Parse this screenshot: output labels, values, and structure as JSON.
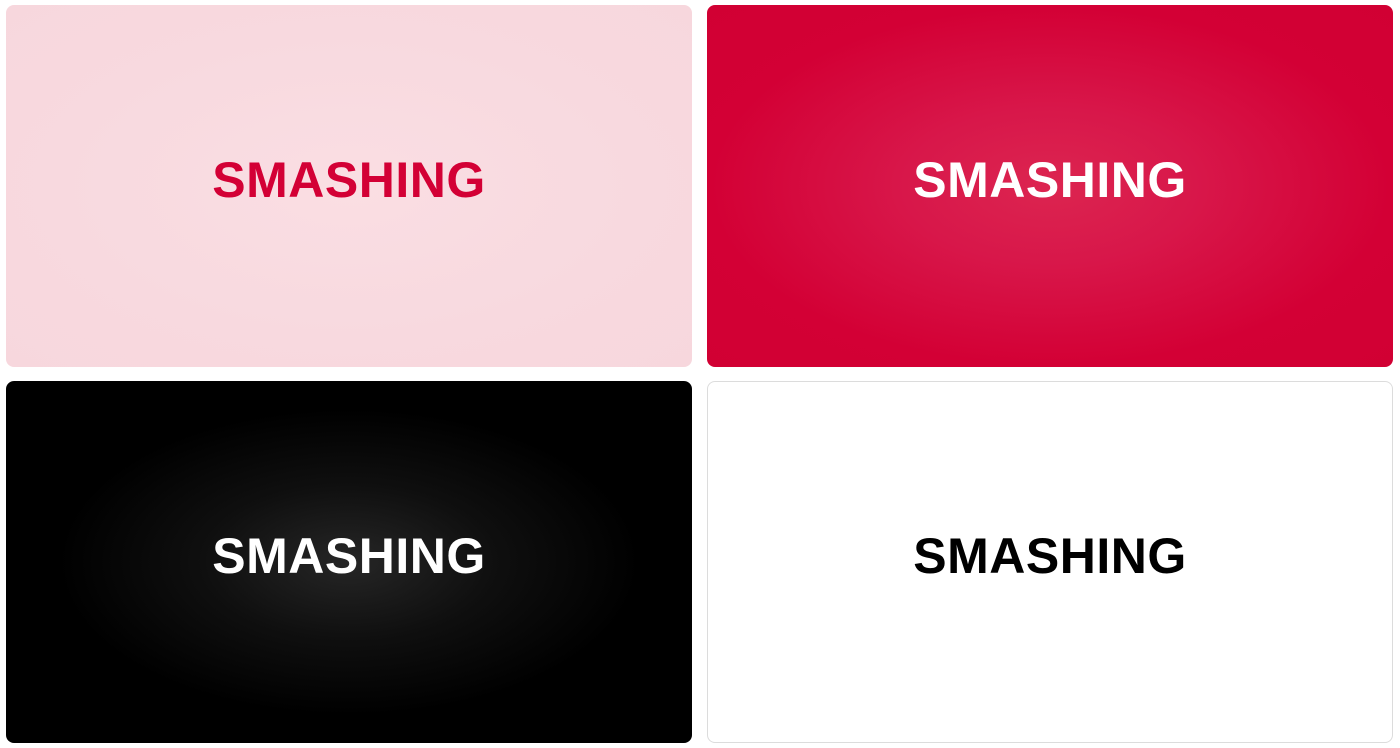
{
  "cards": [
    {
      "id": "pink",
      "text": "SMASHING",
      "background": "#f8d9df",
      "text_color": "#d30035"
    },
    {
      "id": "red",
      "text": "SMASHING",
      "background": "#d30035",
      "text_color": "#ffffff"
    },
    {
      "id": "black",
      "text": "SMASHING",
      "background": "#000000",
      "text_color": "#ffffff"
    },
    {
      "id": "white",
      "text": "SMASHING",
      "background": "#ffffff",
      "text_color": "#000000"
    }
  ]
}
